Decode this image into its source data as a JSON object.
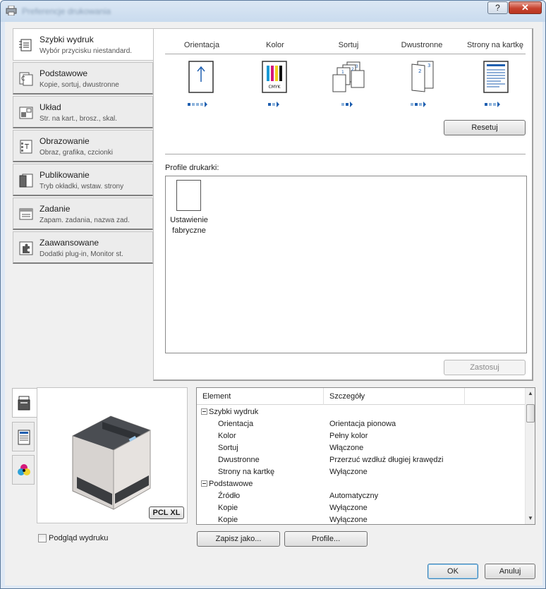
{
  "window": {
    "title": "Preferencje drukowania",
    "help_label": "?",
    "close_label": "✕"
  },
  "tabs": [
    {
      "name": "Szybki wydruk",
      "desc": "Wybór przycisku niestandard.",
      "icon": "quick-print-icon"
    },
    {
      "name": "Podstawowe",
      "desc": "Kopie, sortuj, dwustronne",
      "icon": "copies-icon"
    },
    {
      "name": "Układ",
      "desc": "Str. na kart., brosz., skal.",
      "icon": "layout-icon"
    },
    {
      "name": "Obrazowanie",
      "desc": "Obraz, grafika, czcionki",
      "icon": "imaging-icon"
    },
    {
      "name": "Publikowanie",
      "desc": "Tryb okładki, wstaw. strony",
      "icon": "publishing-icon"
    },
    {
      "name": "Zadanie",
      "desc": "Zapam. zadania, nazwa zad.",
      "icon": "job-icon"
    },
    {
      "name": "Zaawansowane",
      "desc": "Dodatki plug-in, Monitor st.",
      "icon": "advanced-icon"
    }
  ],
  "quick": {
    "columns": [
      {
        "label": "Orientacja",
        "icon": "orientation-portrait-icon"
      },
      {
        "label": "Kolor",
        "icon": "color-cmyk-icon"
      },
      {
        "label": "Sortuj",
        "icon": "collate-icon"
      },
      {
        "label": "Dwustronne",
        "icon": "duplex-icon"
      },
      {
        "label": "Strony na kartkę",
        "icon": "pages-per-sheet-icon"
      }
    ],
    "cmyk_text": "CMYK",
    "reset_label": "Resetuj",
    "profiles_label": "Profile drukarki:",
    "profile_item": "Ustawienie fabryczne",
    "apply_label": "Zastosuj"
  },
  "preview": {
    "badge": "PCL XL",
    "checkbox_label": "Podgląd wydruku"
  },
  "details": {
    "headers": [
      "Element",
      "Szczegóły"
    ],
    "rows": [
      {
        "key": "Szybki wydruk",
        "value": "",
        "group": true
      },
      {
        "key": "Orientacja",
        "value": "Orientacja pionowa",
        "group": false
      },
      {
        "key": "Kolor",
        "value": "Pełny kolor",
        "group": false
      },
      {
        "key": "Sortuj",
        "value": "Włączone",
        "group": false
      },
      {
        "key": "Dwustronne",
        "value": "Przerzuć wzdłuż długiej krawędzi",
        "group": false
      },
      {
        "key": "Strony na kartkę",
        "value": "Wyłączone",
        "group": false
      },
      {
        "key": "Podstawowe",
        "value": "",
        "group": true
      },
      {
        "key": "Źródło",
        "value": "Automatyczny",
        "group": false
      },
      {
        "key": "Kopie",
        "value": "Wyłączone",
        "group": false
      },
      {
        "key": "Kopie",
        "value": "Wyłączone",
        "group": false
      }
    ]
  },
  "footer": {
    "save_as_label": "Zapisz jako...",
    "profiles_label": "Profile...",
    "ok_label": "OK",
    "cancel_label": "Anuluj"
  }
}
